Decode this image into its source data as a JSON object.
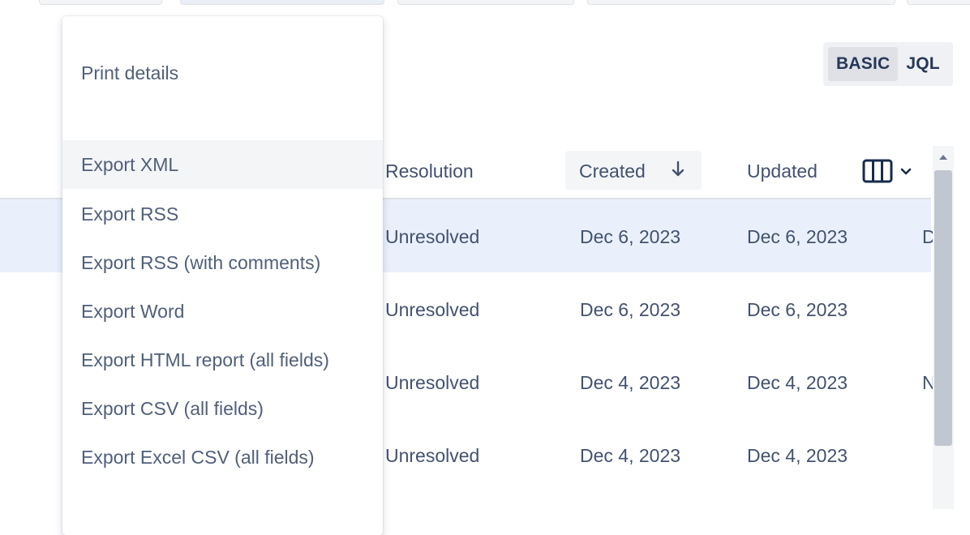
{
  "search_mode": {
    "basic_label": "BASIC",
    "jql_label": "JQL",
    "active": "BASIC"
  },
  "menu": {
    "print_label": "Print details",
    "items": [
      {
        "label": "Export XML"
      },
      {
        "label": "Export RSS"
      },
      {
        "label": "Export RSS (with comments)"
      },
      {
        "label": "Export Word"
      },
      {
        "label": "Export HTML report (all fields)"
      },
      {
        "label": "Export CSV (all fields)"
      },
      {
        "label": "Export Excel CSV (all fields)"
      }
    ],
    "hovered_item": "Export XML"
  },
  "table": {
    "headers": {
      "resolution": "Resolution",
      "created": "Created",
      "updated": "Updated"
    },
    "sort": {
      "column": "Created",
      "direction": "descending"
    },
    "rows": [
      {
        "resolution": "Unresolved",
        "created": "Dec 6, 2023",
        "updated": "Dec 6, 2023",
        "extra": "D",
        "selected": true
      },
      {
        "resolution": "Unresolved",
        "created": "Dec 6, 2023",
        "updated": "Dec 6, 2023",
        "extra": "",
        "selected": false
      },
      {
        "resolution": "Unresolved",
        "created": "Dec 4, 2023",
        "updated": "Dec 4, 2023",
        "extra": "N",
        "selected": false
      },
      {
        "resolution": "Unresolved",
        "created": "Dec 4, 2023",
        "updated": "Dec 4, 2023",
        "extra": "",
        "selected": false
      }
    ]
  },
  "colors": {
    "text": "#42526e",
    "selected_row": "#e9f0fc",
    "hover": "#f4f5f7",
    "divider": "#dfe1e6"
  }
}
